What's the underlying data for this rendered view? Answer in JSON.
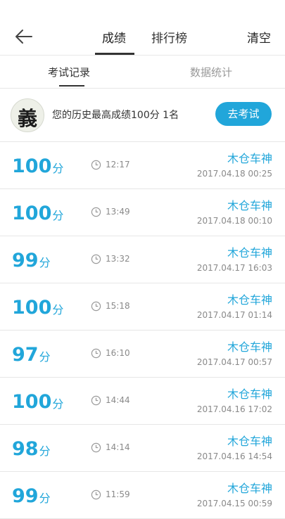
{
  "header": {
    "tabs": [
      "成绩",
      "排行榜"
    ],
    "active_tab": "成绩",
    "clear_label": "清空"
  },
  "subtabs": {
    "items": [
      "考试记录",
      "数据统计"
    ],
    "active": "考试记录"
  },
  "banner": {
    "avatar_char": "義",
    "best_text": "您的历史最高成绩100分  1名",
    "button_label": "去考试"
  },
  "records": [
    {
      "score": "100",
      "unit": "分",
      "time": "12:17",
      "user": "木仓车神",
      "date": "2017.04.18  00:25"
    },
    {
      "score": "100",
      "unit": "分",
      "time": "13:49",
      "user": "木仓车神",
      "date": "2017.04.18  00:10"
    },
    {
      "score": "99",
      "unit": "分",
      "time": "13:32",
      "user": "木仓车神",
      "date": "2017.04.17  16:03"
    },
    {
      "score": "100",
      "unit": "分",
      "time": "15:18",
      "user": "木仓车神",
      "date": "2017.04.17  01:14"
    },
    {
      "score": "97",
      "unit": "分",
      "time": "16:10",
      "user": "木仓车神",
      "date": "2017.04.17  00:57"
    },
    {
      "score": "100",
      "unit": "分",
      "time": "14:44",
      "user": "木仓车神",
      "date": "2017.04.16  17:02"
    },
    {
      "score": "98",
      "unit": "分",
      "time": "14:14",
      "user": "木仓车神",
      "date": "2017.04.16  14:54"
    },
    {
      "score": "99",
      "unit": "分",
      "time": "11:59",
      "user": "木仓车神",
      "date": "2017.04.15  00:59"
    }
  ],
  "icons": {
    "back": "arrow-left-icon",
    "clock": "clock-icon"
  },
  "colors": {
    "accent": "#21a6da"
  }
}
